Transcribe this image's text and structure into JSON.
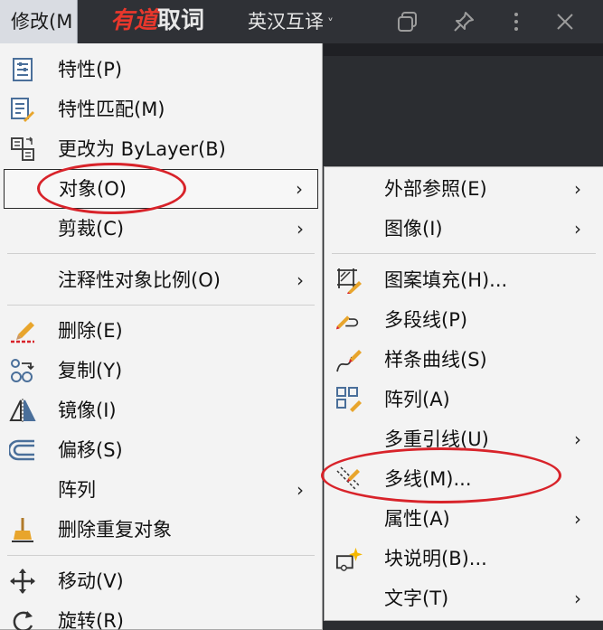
{
  "menubar": {
    "tab_label": "修改(M"
  },
  "topbar": {
    "brand_part1": "有道",
    "brand_part2": "取词",
    "mode_label": "英汉互译",
    "mode_chevron": "˅",
    "icons": [
      "copy-icon",
      "pin-icon",
      "more-icon",
      "close-icon"
    ]
  },
  "main_menu": {
    "items": [
      {
        "label": "特性(P)",
        "icon": "properties-icon",
        "arrow": ""
      },
      {
        "label": "特性匹配(M)",
        "icon": "match-properties-icon",
        "arrow": ""
      },
      {
        "label": "更改为 ByLayer(B)",
        "icon": "change-bylayer-icon",
        "arrow": ""
      },
      {
        "label": "对象(O)",
        "icon": "",
        "arrow": "›"
      },
      {
        "label": "剪裁(C)",
        "icon": "",
        "arrow": "›"
      },
      {
        "label": "注释性对象比例(O)",
        "icon": "",
        "arrow": "›"
      },
      {
        "label": "删除(E)",
        "icon": "erase-icon",
        "arrow": ""
      },
      {
        "label": "复制(Y)",
        "icon": "copy-object-icon",
        "arrow": ""
      },
      {
        "label": "镜像(I)",
        "icon": "mirror-icon",
        "arrow": ""
      },
      {
        "label": "偏移(S)",
        "icon": "offset-icon",
        "arrow": ""
      },
      {
        "label": "阵列",
        "icon": "",
        "arrow": "›"
      },
      {
        "label": "删除重复对象",
        "icon": "overkill-icon",
        "arrow": ""
      },
      {
        "label": "移动(V)",
        "icon": "move-icon",
        "arrow": ""
      },
      {
        "label": "旋转(R)",
        "icon": "rotate-icon",
        "arrow": ""
      }
    ]
  },
  "sub_menu": {
    "items": [
      {
        "label": "外部参照(E)",
        "icon": "",
        "arrow": "›"
      },
      {
        "label": "图像(I)",
        "icon": "",
        "arrow": "›"
      },
      {
        "label": "图案填充(H)...",
        "icon": "hatch-edit-icon",
        "arrow": ""
      },
      {
        "label": "多段线(P)",
        "icon": "polyline-edit-icon",
        "arrow": ""
      },
      {
        "label": "样条曲线(S)",
        "icon": "spline-edit-icon",
        "arrow": ""
      },
      {
        "label": "阵列(A)",
        "icon": "array-edit-icon",
        "arrow": ""
      },
      {
        "label": "多重引线(U)",
        "icon": "",
        "arrow": "›"
      },
      {
        "label": "多线(M)...",
        "icon": "multiline-edit-icon",
        "arrow": ""
      },
      {
        "label": "属性(A)",
        "icon": "",
        "arrow": "›"
      },
      {
        "label": "块说明(B)...",
        "icon": "block-description-icon",
        "arrow": ""
      },
      {
        "label": "文字(T)",
        "icon": "",
        "arrow": "›"
      }
    ]
  },
  "colors": {
    "highlight_ellipse": "#d8232a",
    "menu_bg": "#f3f3f3",
    "topbar_bg": "#2f3136"
  }
}
